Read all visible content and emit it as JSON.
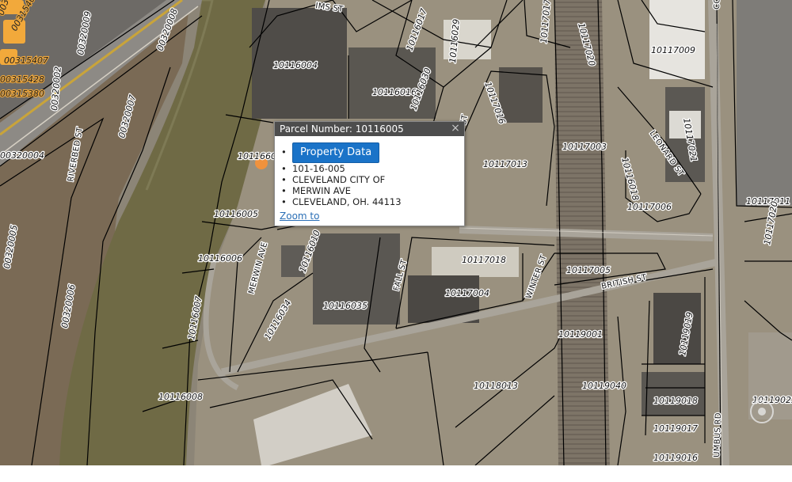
{
  "popup": {
    "title": "Parcel Number: 10116005",
    "close_glyph": "×",
    "button_label": "Property Data",
    "details": [
      "101-16-005",
      "CLEVELAND CITY OF",
      "MERWIN AVE",
      "CLEVELAND, OH. 44113"
    ],
    "zoom_label": "Zoom to"
  },
  "parcels": [
    "10116004",
    "10116016",
    "10116030",
    "10116017",
    "10116029",
    "10116005",
    "10116006",
    "10116007",
    "10116008",
    "10116010",
    "10116034",
    "10116035",
    "10117018",
    "10117004",
    "10117005",
    "10117003",
    "10117013",
    "10117016",
    "10117017",
    "10117020",
    "10117009",
    "10117021",
    "10117006",
    "10117011",
    "10117020",
    "10119001",
    "10119019",
    "10119018",
    "10119017",
    "10119016",
    "10119040",
    "10118013",
    "10119023",
    "10116601",
    "10116018"
  ],
  "orange_parcels": [
    "00315086",
    "00315404",
    "00315407",
    "00315428",
    "00315380"
  ],
  "parcels_west": [
    "00320008",
    "00320009",
    "00320007",
    "00320002",
    "00320004",
    "00320005",
    "00320006"
  ],
  "streets": {
    "riverbed": "RIVERBED ST",
    "merwin": "MERWIN AVE",
    "fall": "FALL ST",
    "winter": "WINTER ST",
    "british": "BRITISH ST",
    "leonard": "LEONARD ST",
    "columbus": "UMBUS RD",
    "sims": "IMS ST",
    "st": "ST",
    "co": "CO"
  },
  "colors": {
    "river": "#6f6a45",
    "land": "#8c8577",
    "popup_header": "#4d4d4d",
    "button": "#1a73c8",
    "marker": "#f0923d"
  }
}
